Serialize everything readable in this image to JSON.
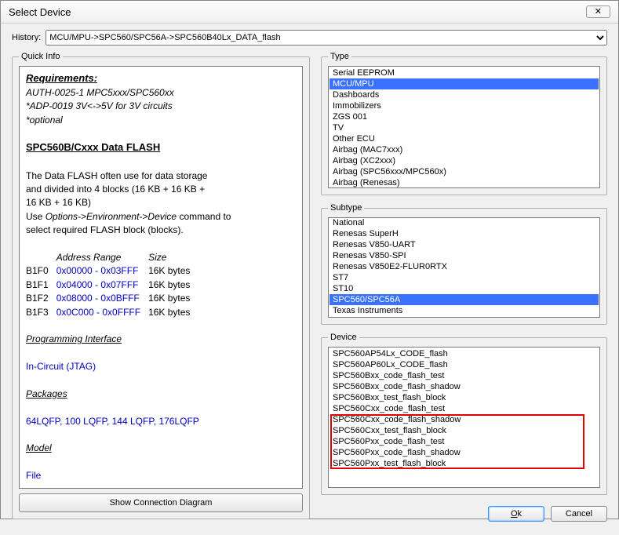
{
  "window": {
    "title": "Select Device",
    "close_glyph": "✕"
  },
  "history": {
    "label": "History:",
    "value": "MCU/MPU->SPC560/SPC56A->SPC560B40Lx_DATA_flash"
  },
  "quick_info": {
    "legend": "Quick Info",
    "requirements_heading": "Requirements:",
    "req_line1": "AUTH-0025-1 MPC5xxx/SPC560xx",
    "req_line2": "*ADP-0019 3V<->5V for 3V circuits",
    "req_line3": "*optional",
    "section_title": "SPC560B/Cxxx Data FLASH",
    "desc1": "The Data FLASH often use for data storage",
    "desc2": "and divided into 4 blocks (16 KB + 16 KB +",
    "desc3": "16 KB + 16 KB)",
    "desc4_pre": "Use ",
    "desc4_mid": "Options->Environment->Device",
    "desc4_post": " command to",
    "desc5": "select required FLASH block (blocks).",
    "table_headers": {
      "c1": "",
      "c2": "Address Range",
      "c3": "Size"
    },
    "table_rows": [
      {
        "b": "B1F0",
        "r": "0x00000 - 0x03FFF",
        "s": "16K bytes"
      },
      {
        "b": "B1F1",
        "r": "0x04000 - 0x07FFF",
        "s": "16K bytes"
      },
      {
        "b": "B1F2",
        "r": "0x08000 - 0x0BFFF",
        "s": "16K bytes"
      },
      {
        "b": "B1F3",
        "r": "0x0C000 - 0x0FFFF",
        "s": "16K bytes"
      }
    ],
    "prog_iface_heading": "Programming Interface",
    "prog_iface_value": "In-Circuit (JTAG)",
    "packages_heading": "Packages",
    "packages_value": "64LQFP, 100 LQFP, 144 LQFP, 176LQFP",
    "model_heading": "Model",
    "model_value": "File",
    "show_conn_btn": "Show Connection Diagram"
  },
  "type": {
    "legend": "Type",
    "items": [
      "Serial EEPROM",
      "MCU/MPU",
      "Dashboards",
      "Immobilizers",
      "ZGS 001",
      "TV",
      "Other ECU",
      "Airbag (MAC7xxx)",
      "Airbag (XC2xxx)",
      "Airbag (SPC56xxx/MPC560x)",
      "Airbag (Renesas)"
    ],
    "selected_index": 1
  },
  "subtype": {
    "legend": "Subtype",
    "items": [
      "National",
      "Renesas SuperH",
      "Renesas V850-UART",
      "Renesas V850-SPI",
      "Renesas V850E2-FLUR0RTX",
      "ST7",
      "ST10",
      "SPC560/SPC56A",
      "Texas Instruments"
    ],
    "selected_index": 7
  },
  "device": {
    "legend": "Device",
    "items": [
      "SPC560AP54Lx_CODE_flash",
      "SPC560AP60Lx_CODE_flash",
      "SPC560Bxx_code_flash_test",
      "SPC560Bxx_code_flash_shadow",
      "SPC560Bxx_test_flash_block",
      "SPC560Cxx_code_flash_test",
      "SPC560Cxx_code_flash_shadow",
      "SPC560Cxx_test_flash_block",
      "SPC560Pxx_code_flash_test",
      "SPC560Pxx_code_flash_shadow",
      "SPC560Pxx_test_flash_block"
    ],
    "highlight_start": 6,
    "highlight_end": 10
  },
  "buttons": {
    "ok": "Ok",
    "cancel": "Cancel"
  }
}
